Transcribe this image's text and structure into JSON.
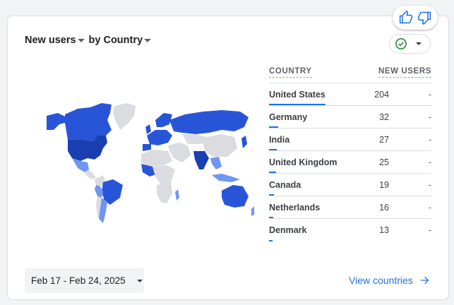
{
  "card": {
    "metric_label": "New users",
    "by_label": "by",
    "dimension_label": "Country"
  },
  "table": {
    "header_country": "COUNTRY",
    "header_metric": "NEW USERS",
    "rows": [
      {
        "country": "United States",
        "value": "204",
        "trend": "-",
        "share": 1.0
      },
      {
        "country": "Germany",
        "value": "32",
        "trend": "-",
        "share": 0.157
      },
      {
        "country": "India",
        "value": "27",
        "trend": "-",
        "share": 0.132
      },
      {
        "country": "United Kingdom",
        "value": "25",
        "trend": "-",
        "share": 0.123
      },
      {
        "country": "Canada",
        "value": "19",
        "trend": "-",
        "share": 0.093
      },
      {
        "country": "Netherlands",
        "value": "16",
        "trend": "-",
        "share": 0.078
      },
      {
        "country": "Denmark",
        "value": "13",
        "trend": "-",
        "share": 0.064
      }
    ]
  },
  "footer": {
    "date_range": "Feb 17 - Feb 24, 2025",
    "view_link": "View countries"
  },
  "colors": {
    "accent": "#1a73e8",
    "map_high": "#1a3fb0",
    "map_mid": "#2855d8",
    "map_low": "#6f96f0",
    "map_none": "#dadce0",
    "status_green": "#188038"
  },
  "icons": {
    "thumbs_up": "thumb-up-icon",
    "thumbs_down": "thumb-down-icon",
    "status": "check-circle-icon",
    "arrow": "arrow-right-icon"
  }
}
